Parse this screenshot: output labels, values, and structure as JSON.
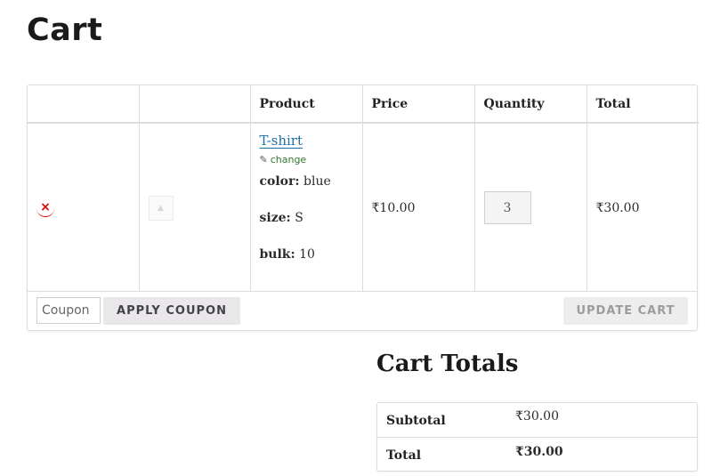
{
  "page": {
    "title": "Cart"
  },
  "cart_table": {
    "headers": [
      "",
      "",
      "Product",
      "Price",
      "Quantity",
      "Total"
    ],
    "items": [
      {
        "remove_icon": "×",
        "product_name": "T-shirt",
        "change_label": "change",
        "attributes": [
          {
            "label": "color:",
            "value": "blue"
          },
          {
            "label": "size:",
            "value": "S"
          },
          {
            "label": "bulk:",
            "value": "10"
          }
        ],
        "price": "₹10.00",
        "quantity": "3",
        "total": "₹30.00"
      }
    ]
  },
  "actions": {
    "coupon_placeholder": "Coupon",
    "apply_coupon_label": "APPLY COUPON",
    "update_cart_label": "UPDATE CART"
  },
  "cart_totals": {
    "title": "Cart Totals",
    "rows": [
      {
        "label": "Subtotal",
        "value": "₹30.00"
      },
      {
        "label": "Total",
        "value": "₹30.00"
      }
    ]
  },
  "colors": {
    "link": "#1f6fa8",
    "remove": "#dd0000",
    "change_link": "#2c7a2c",
    "apply_button_bg": "#e9e7ea",
    "update_button_bg": "#ededed"
  },
  "icons": {
    "remove": "remove-x-icon",
    "thumbnail": "image-placeholder-icon",
    "change": "pencil-icon"
  }
}
